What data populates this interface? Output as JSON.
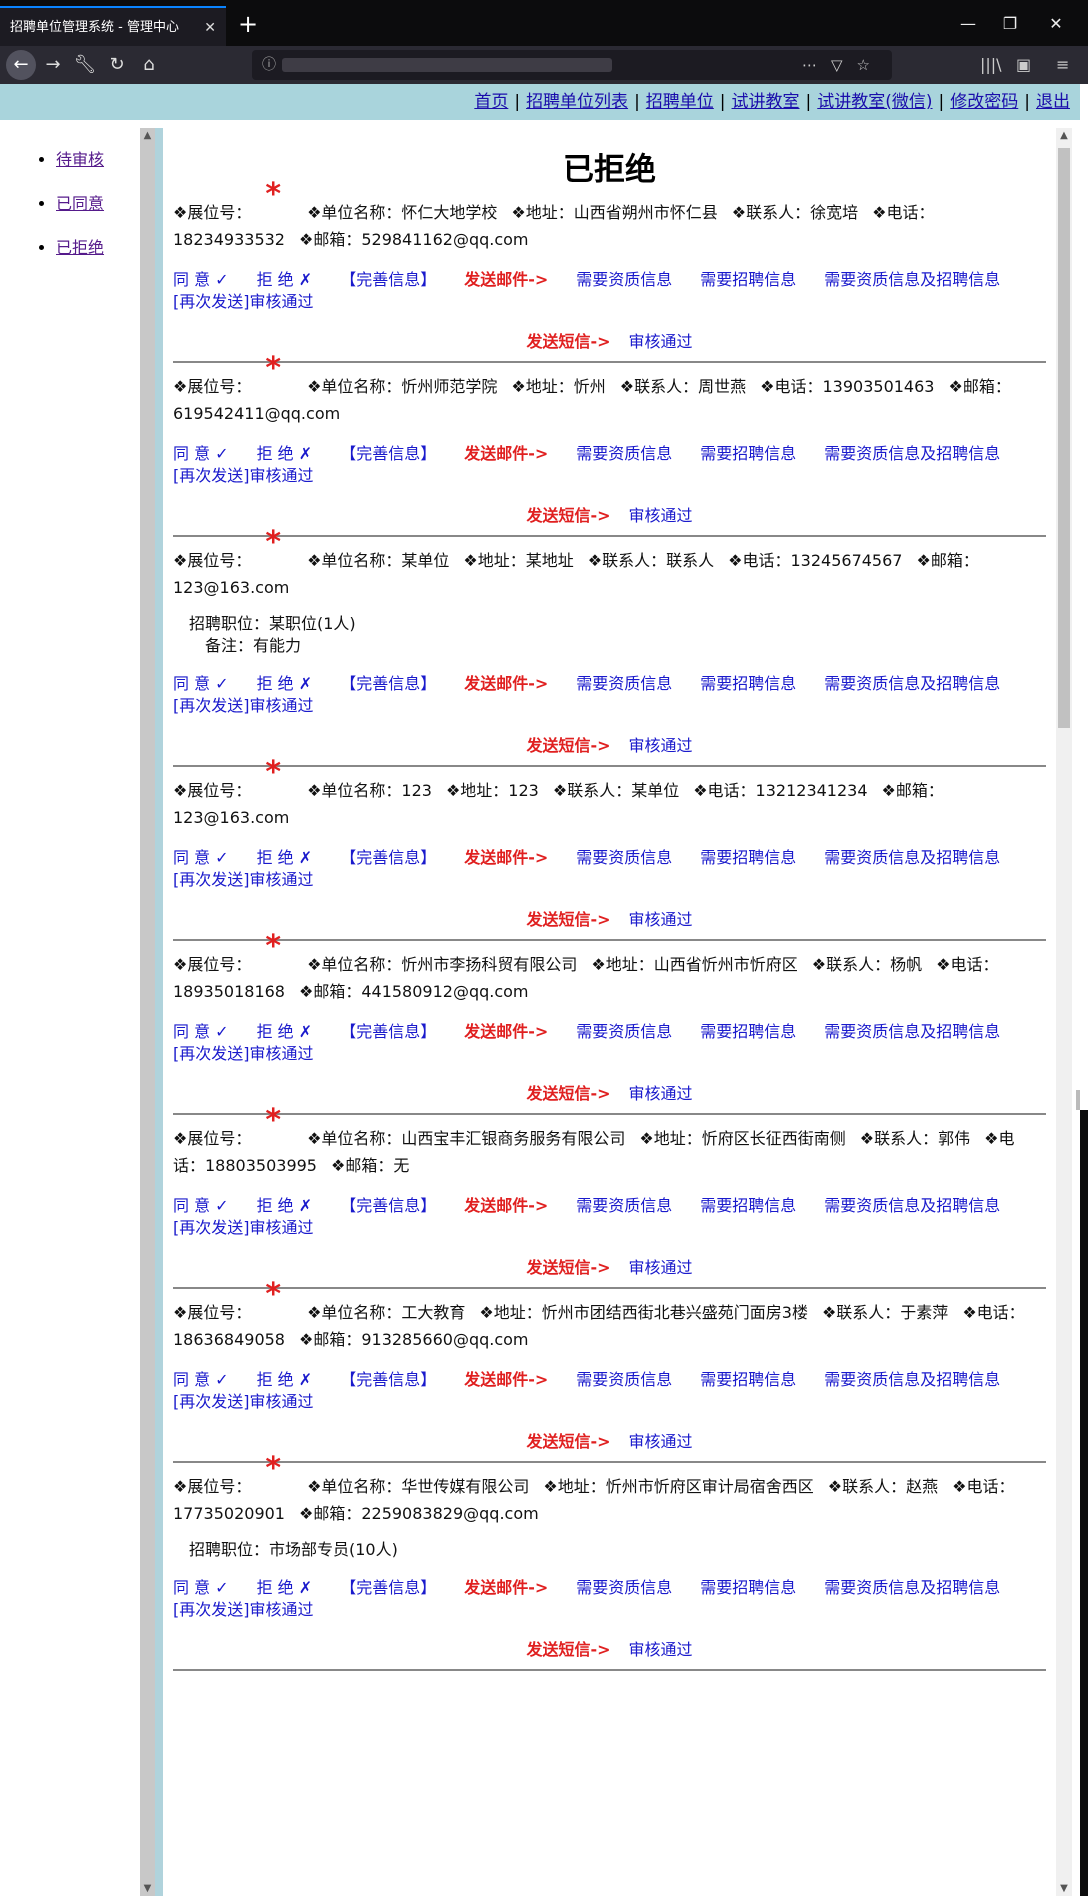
{
  "browser": {
    "tab_title": "招聘单位管理系统 - 管理中心",
    "tab_close": "✕",
    "new_tab": "+"
  },
  "topmenu": [
    {
      "label": "首页"
    },
    {
      "label": "招聘单位列表"
    },
    {
      "label": "招聘单位"
    },
    {
      "label": "试讲教室"
    },
    {
      "label": "试讲教室(微信)"
    },
    {
      "label": "修改密码"
    },
    {
      "label": "退出"
    }
  ],
  "sidebar": {
    "items": [
      {
        "label": "待审核"
      },
      {
        "label": "已同意"
      },
      {
        "label": "已拒绝"
      }
    ]
  },
  "page_title": "已拒绝",
  "labels": {
    "booth": "❖展位号：",
    "star": "*",
    "agree": "同 意 ✓",
    "reject": "拒 绝 ✗",
    "complete": "【完善信息】",
    "send_mail": "发送邮件->",
    "need_qual": "需要资质信息",
    "need_recruit": "需要招聘信息",
    "need_both": "需要资质信息及招聘信息",
    "resend": "[再次发送]审核通过",
    "send_sms": "发送短信->",
    "approved": "审核通过"
  },
  "entries": [
    {
      "unit": "❖单位名称：怀仁大地学校",
      "addr": "❖地址：山西省朔州市怀仁县",
      "contact": "❖联系人：徐宽培",
      "phone": "❖电话：18234933532",
      "email": "❖邮箱：529841162@qq.com",
      "position": "",
      "note": ""
    },
    {
      "unit": "❖单位名称：忻州师范学院",
      "addr": "❖地址：忻州",
      "contact": "❖联系人：周世燕",
      "phone": "❖电话：13903501463",
      "email": "❖邮箱：619542411@qq.com",
      "position": "",
      "note": ""
    },
    {
      "unit": "❖单位名称：某单位",
      "addr": "❖地址：某地址",
      "contact": "❖联系人：联系人",
      "phone": "❖电话：13245674567",
      "email": "❖邮箱：123@163.com",
      "position": "招聘职位：某职位(1人)",
      "note": "备注：有能力"
    },
    {
      "unit": "❖单位名称：123",
      "addr": "❖地址：123",
      "contact": "❖联系人：某单位",
      "phone": "❖电话：13212341234",
      "email": "❖邮箱：123@163.com",
      "position": "",
      "note": ""
    },
    {
      "unit": "❖单位名称：忻州市李扬科贸有限公司",
      "addr": "❖地址：山西省忻州市忻府区",
      "contact": "❖联系人：杨帆",
      "phone": "❖电话：18935018168",
      "email": "❖邮箱：441580912@qq.com",
      "position": "",
      "note": ""
    },
    {
      "unit": "❖单位名称：山西宝丰汇银商务服务有限公司",
      "addr": "❖地址：忻府区长征西街南侧",
      "contact": "❖联系人：郭伟",
      "phone": "❖电话：18803503995",
      "email": "❖邮箱：无",
      "position": "",
      "note": ""
    },
    {
      "unit": "❖单位名称：工大教育",
      "addr": "❖地址：忻州市团结西街北巷兴盛苑门面房3楼",
      "contact": "❖联系人：于素萍",
      "phone": "❖电话：18636849058",
      "email": "❖邮箱：913285660@qq.com",
      "position": "",
      "note": ""
    },
    {
      "unit": "❖单位名称：华世传媒有限公司",
      "addr": "❖地址：忻州市忻府区审计局宿舍西区",
      "contact": "❖联系人：赵燕",
      "phone": "❖电话：17735020901",
      "email": "❖邮箱：2259083829@qq.com",
      "position": "招聘职位：市场部专员(10人)",
      "note": ""
    }
  ]
}
